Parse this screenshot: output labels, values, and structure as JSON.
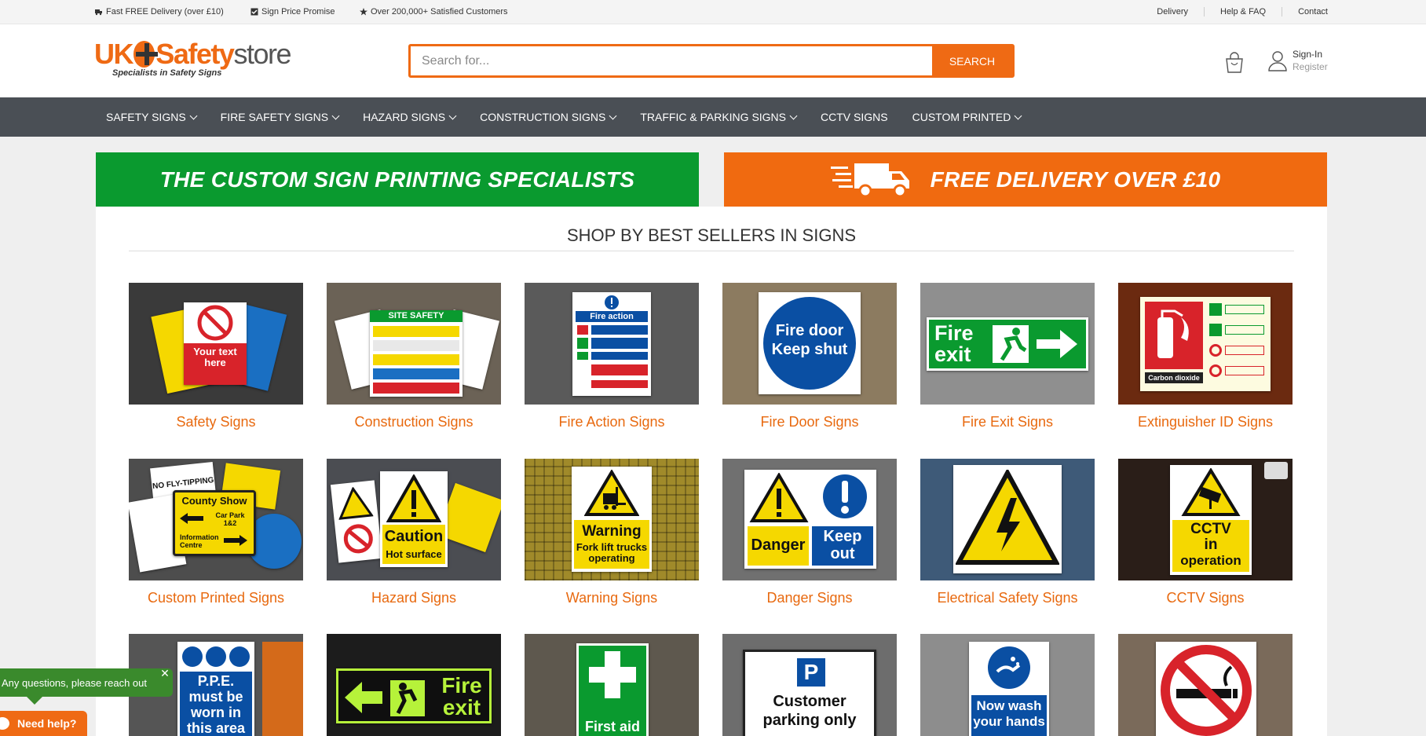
{
  "topbar": {
    "usps": [
      "Fast FREE Delivery (over £10)",
      "Sign Price Promise",
      "Over 200,000+ Satisfied Customers"
    ],
    "links": [
      "Delivery",
      "Help & FAQ",
      "Contact"
    ]
  },
  "header": {
    "logo_uk": "UK",
    "logo_safety": "Safety",
    "logo_store": "store",
    "logo_tagline": "Specialists in Safety Signs",
    "search_placeholder": "Search for...",
    "search_button": "SEARCH",
    "sign_in": "Sign-In",
    "register": "Register"
  },
  "nav": {
    "items": [
      "SAFETY SIGNS",
      "FIRE SAFETY SIGNS",
      "HAZARD SIGNS",
      "CONSTRUCTION SIGNS",
      "TRAFFIC & PARKING SIGNS",
      "CCTV SIGNS",
      "CUSTOM PRINTED"
    ]
  },
  "banners": {
    "left": "THE CUSTOM SIGN PRINTING SPECIALISTS",
    "right": "FREE DELIVERY OVER £10"
  },
  "section_title": "SHOP BY BEST SELLERS IN SIGNS",
  "tiles": [
    {
      "label": "Safety Signs"
    },
    {
      "label": "Construction Signs"
    },
    {
      "label": "Fire Action Signs"
    },
    {
      "label": "Fire Door Signs"
    },
    {
      "label": "Fire Exit Signs"
    },
    {
      "label": "Extinguisher ID Signs"
    },
    {
      "label": "Custom Printed Signs"
    },
    {
      "label": "Hazard Signs"
    },
    {
      "label": "Warning Signs"
    },
    {
      "label": "Danger Signs"
    },
    {
      "label": "Electrical Safety Signs"
    },
    {
      "label": "CCTV Signs"
    }
  ],
  "sign_text": {
    "your_text": "Your text here",
    "site_safety": "SITE SAFETY",
    "fire_action": "Fire action",
    "fire_door_1": "Fire door",
    "fire_door_2": "Keep shut",
    "fire_exit_1": "Fire",
    "fire_exit_2": "exit",
    "carbon_dioxide": "Carbon dioxide",
    "county_show": "County Show",
    "car_park": "Car Park 1&2",
    "info_centre": "Information Centre",
    "no_fly_tipping": "NO FLY-TIPPING",
    "caution": "Caution",
    "hot_surface": "Hot surface",
    "warning": "Warning",
    "fork_lift": "Fork lift trucks operating",
    "danger": "Danger",
    "keep_out_1": "Keep",
    "keep_out_2": "out",
    "cctv_1": "CCTV",
    "cctv_2": "in",
    "cctv_3": "operation",
    "ppe": "P.P.E. must be worn in this area",
    "first_aid": "First aid",
    "customer_1": "Customer",
    "customer_2": "parking only",
    "wash_1": "Now wash",
    "wash_2": "your hands"
  },
  "chat": {
    "bubble": "Any questions, please reach out",
    "button": "Need help?"
  },
  "colors": {
    "brand_orange": "#ef6a14",
    "brand_green": "#0a9a2f",
    "nav_bg": "#4a4f55"
  }
}
